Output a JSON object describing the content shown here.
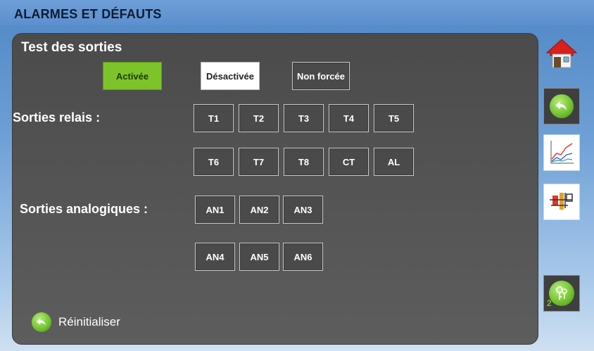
{
  "header": {
    "title": "ALARMES ET DÉFAUTS"
  },
  "test_section": {
    "title": "Test des sorties",
    "legend": [
      {
        "label": "Activée",
        "state": "active",
        "color": "#7dc42a"
      },
      {
        "label": "Désactivée",
        "state": "inactive",
        "color": "#ffffff"
      },
      {
        "label": "Non forcée",
        "state": "not-forced",
        "color": "#4a4a4a"
      }
    ]
  },
  "relay_outputs": {
    "label": "Sorties relais :",
    "buttons": [
      "T1",
      "T2",
      "T3",
      "T4",
      "T5",
      "T6",
      "T7",
      "T8",
      "CT",
      "AL"
    ]
  },
  "analog_outputs": {
    "label": "Sorties analogiques :",
    "buttons": [
      "AN1",
      "AN2",
      "AN3",
      "AN4",
      "AN5",
      "AN6"
    ]
  },
  "reset": {
    "label": "Réinitialiser"
  },
  "sidebar": {
    "items": [
      {
        "name": "home",
        "icon": "house-icon"
      },
      {
        "name": "back",
        "icon": "back-arrow-icon"
      },
      {
        "name": "trends",
        "icon": "line-chart-icon"
      },
      {
        "name": "synoptic",
        "icon": "hydraulic-diagram-icon"
      },
      {
        "name": "access-level",
        "icon": "keys-icon",
        "badge": "2"
      }
    ]
  }
}
